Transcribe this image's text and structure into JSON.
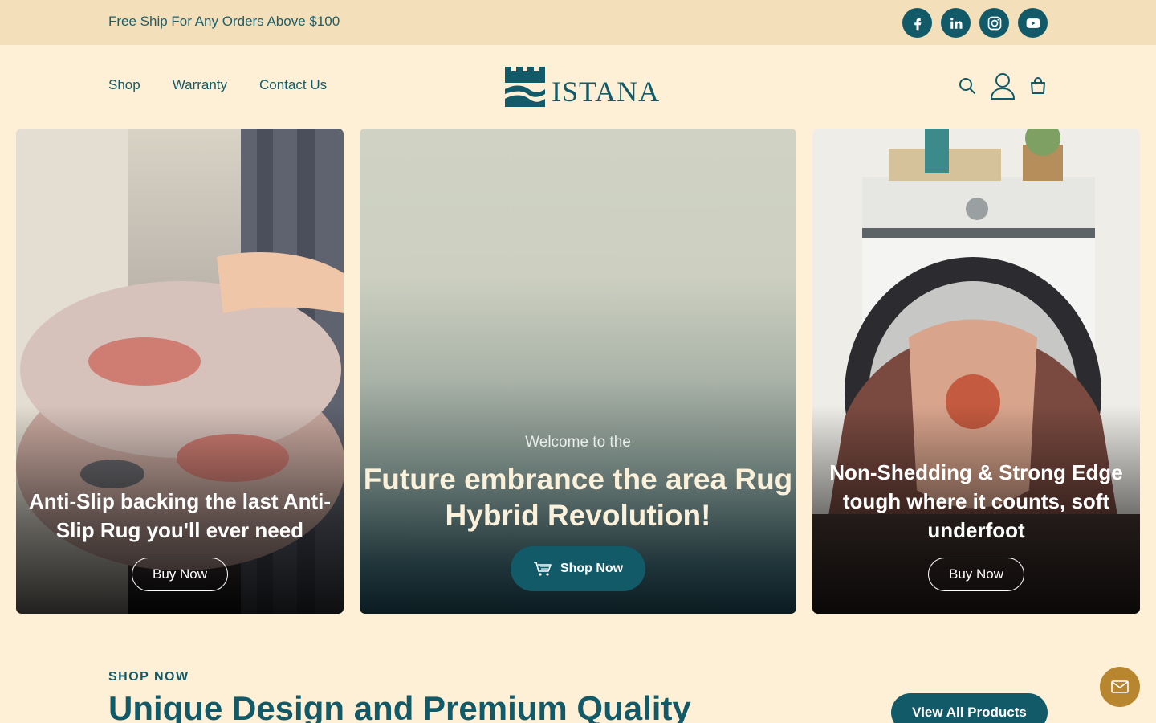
{
  "topbar": {
    "promo": "Free Ship For Any Orders Above $100",
    "socials": [
      {
        "icon": "facebook-icon"
      },
      {
        "icon": "linkedin-icon"
      },
      {
        "icon": "instagram-icon"
      },
      {
        "icon": "youtube-icon"
      }
    ]
  },
  "nav": {
    "items": [
      "Shop",
      "Warranty",
      "Contact Us"
    ],
    "logo_text": "ISTANA",
    "icons": [
      "search-icon",
      "account-icon",
      "cart-icon"
    ]
  },
  "hero": {
    "left": {
      "title": "Anti-Slip backing the last Anti-Slip Rug you'll ever need",
      "button": "Buy Now"
    },
    "center": {
      "kicker": "Welcome to the",
      "title": "Future embrance the area Rug Hybrid Revolution!",
      "button": "Shop Now"
    },
    "right": {
      "title": "Non-Shedding & Strong Edge tough where it counts, soft underfoot",
      "button": "Buy Now"
    }
  },
  "section": {
    "kicker": "SHOP NOW",
    "title": "Unique Design and Premium Quality",
    "button": "View All Products"
  },
  "colors": {
    "primary": "#135a69",
    "topbar_bg": "#f3e0bb",
    "page_bg": "#fdf0d6",
    "accent_gold": "#b8862f"
  }
}
